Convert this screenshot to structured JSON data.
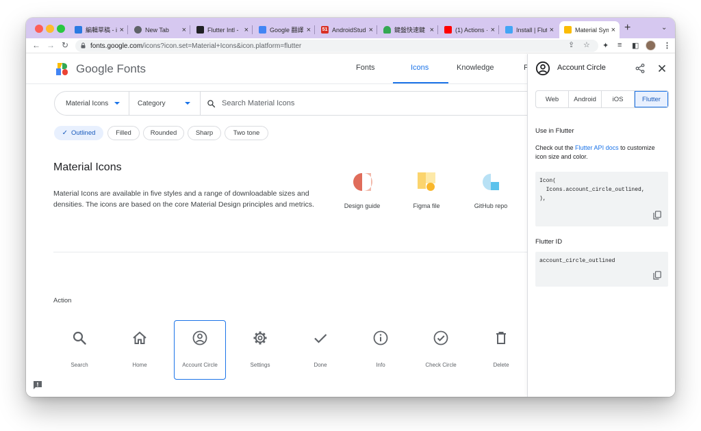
{
  "browser": {
    "tabs": [
      {
        "title": "編輯草稿 - iT",
        "favicon_color": "#2a7ae2",
        "favicon_text": ""
      },
      {
        "title": "New Tab",
        "favicon_color": "#5f6368",
        "favicon_text": ""
      },
      {
        "title": "Flutter Intl -",
        "favicon_color": "#202124",
        "favicon_text": ""
      },
      {
        "title": "Google 翻譯",
        "favicon_color": "#4285f4",
        "favicon_text": ""
      },
      {
        "title": "AndroidStud",
        "favicon_color": "#d93025",
        "favicon_text": "51"
      },
      {
        "title": "鍵盤快速鍵",
        "favicon_color": "#34a853",
        "favicon_text": ""
      },
      {
        "title": "(1) Actions ·",
        "favicon_color": "#ff0000",
        "favicon_text": ""
      },
      {
        "title": "Install | Flutt",
        "favicon_color": "#42a5f5",
        "favicon_text": ""
      },
      {
        "title": "Material Sym",
        "favicon_color": "#fbbc04",
        "favicon_text": ""
      }
    ],
    "new_tab_symbol": "+",
    "tab_menu_symbol": "⌄",
    "close_symbol": "×",
    "back_symbol": "←",
    "forward_symbol": "→",
    "reload_symbol": "↻",
    "url_host": "fonts.google.com",
    "url_path": "/icons?icon.set=Material+Icons&icon.platform=flutter",
    "share_symbol": "⇪",
    "star_symbol": "☆",
    "extension_symbol": "✦",
    "readinglist_symbol": "≡",
    "sidepanel_symbol": "◧",
    "menu_symbol": "⋮"
  },
  "header": {
    "brand": "Google Fonts",
    "nav": [
      "Fonts",
      "Icons",
      "Knowledge",
      "F"
    ],
    "active_nav": "Icons"
  },
  "search": {
    "icon_set": "Material Icons",
    "category": "Category",
    "placeholder": "Search Material Icons"
  },
  "styles": {
    "check_symbol": "✓",
    "chips": [
      "Outlined",
      "Filled",
      "Rounded",
      "Sharp",
      "Two tone"
    ],
    "selected": "Outlined"
  },
  "intro": {
    "title": "Material Icons",
    "description": "Material Icons are available in five styles and a range of downloadable sizes and densities. The icons are based on the core Material Design principles and metrics.",
    "resources": [
      "Design guide",
      "Figma file",
      "GitHub repo"
    ]
  },
  "section": {
    "title": "Action",
    "icons": [
      {
        "label": "Search",
        "icon": "search-icon"
      },
      {
        "label": "Home",
        "icon": "home-icon"
      },
      {
        "label": "Account Circle",
        "icon": "account-circle-icon"
      },
      {
        "label": "Settings",
        "icon": "settings-icon"
      },
      {
        "label": "Done",
        "icon": "done-icon"
      },
      {
        "label": "Info",
        "icon": "info-icon"
      },
      {
        "label": "Check Circle",
        "icon": "check-circle-icon"
      },
      {
        "label": "Delete",
        "icon": "delete-icon"
      }
    ],
    "selected_icon": "Account Circle"
  },
  "panel": {
    "title": "Account Circle",
    "share_symbol": "<",
    "close_symbol": "✕",
    "platforms": [
      "Web",
      "Android",
      "iOS",
      "Flutter"
    ],
    "active_platform": "Flutter",
    "use_heading": "Use in Flutter",
    "use_text_before": "Check out the ",
    "use_link": "Flutter API docs",
    "use_text_after": " to customize icon size and color.",
    "code": "Icon(\n  Icons.account_circle_outlined,\n),",
    "id_heading": "Flutter ID",
    "flutter_id": "account_circle_outlined"
  },
  "colors": {
    "accent": "#1a73e8",
    "tabstrip": "#d6c8f0",
    "code_bg": "#f1f3f4"
  }
}
